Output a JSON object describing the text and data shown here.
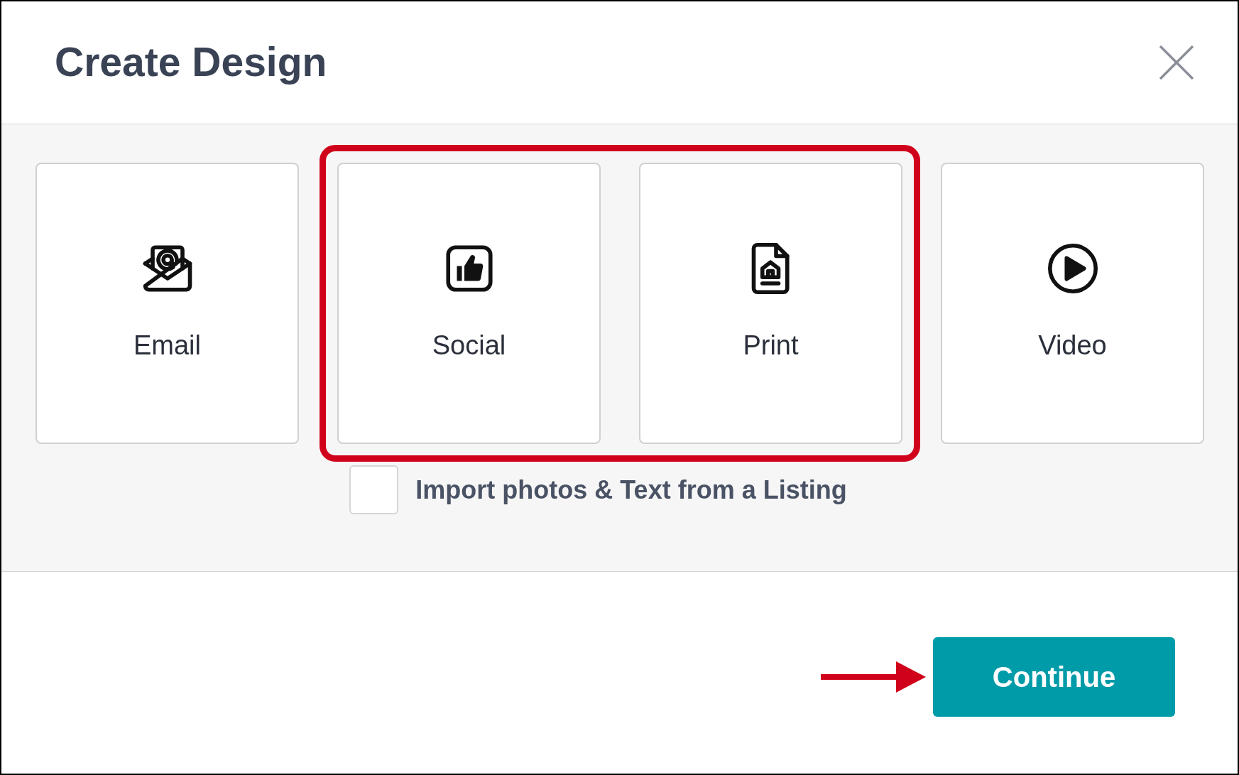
{
  "dialog": {
    "title": "Create Design"
  },
  "card_groups": [
    {
      "highlighted": false,
      "cards": [
        {
          "kind": "email",
          "label": "Email"
        }
      ]
    },
    {
      "highlighted": true,
      "cards": [
        {
          "kind": "social",
          "label": "Social"
        },
        {
          "kind": "print",
          "label": "Print"
        }
      ]
    },
    {
      "highlighted": false,
      "cards": [
        {
          "kind": "video",
          "label": "Video"
        }
      ]
    }
  ],
  "import_option": {
    "label": "Import photos & Text from a Listing",
    "checked": false
  },
  "continue_button": {
    "label": "Continue",
    "pointed_at": true
  }
}
